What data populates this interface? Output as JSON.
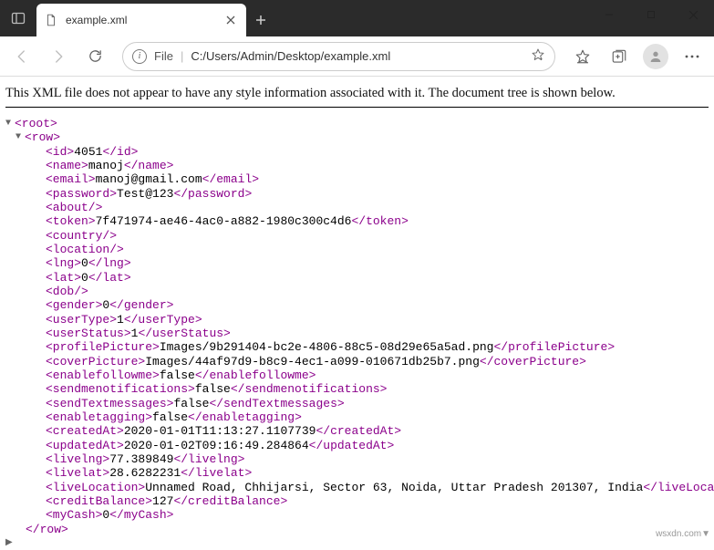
{
  "window": {
    "tab_label": "example.xml",
    "url_proto": "File",
    "url_path": "C:/Users/Admin/Desktop/example.xml"
  },
  "notice": "This XML file does not appear to have any style information associated with it. The document tree is shown below.",
  "xml": {
    "root_name": "root",
    "row_name": "row",
    "row_close": "</row>",
    "fields": [
      {
        "tag": "id",
        "value": "4051"
      },
      {
        "tag": "name",
        "value": "manoj"
      },
      {
        "tag": "email",
        "value": "manoj@gmail.com"
      },
      {
        "tag": "password",
        "value": "Test@123"
      },
      {
        "tag": "about",
        "empty": true
      },
      {
        "tag": "token",
        "value": "7f471974-ae46-4ac0-a882-1980c300c4d6"
      },
      {
        "tag": "country",
        "empty": true
      },
      {
        "tag": "location",
        "empty": true
      },
      {
        "tag": "lng",
        "value": "0"
      },
      {
        "tag": "lat",
        "value": "0"
      },
      {
        "tag": "dob",
        "empty": true
      },
      {
        "tag": "gender",
        "value": "0"
      },
      {
        "tag": "userType",
        "value": "1"
      },
      {
        "tag": "userStatus",
        "value": "1"
      },
      {
        "tag": "profilePicture",
        "value": "Images/9b291404-bc2e-4806-88c5-08d29e65a5ad.png"
      },
      {
        "tag": "coverPicture",
        "value": "Images/44af97d9-b8c9-4ec1-a099-010671db25b7.png"
      },
      {
        "tag": "enablefollowme",
        "value": "false"
      },
      {
        "tag": "sendmenotifications",
        "value": "false"
      },
      {
        "tag": "sendTextmessages",
        "value": "false"
      },
      {
        "tag": "enabletagging",
        "value": "false"
      },
      {
        "tag": "createdAt",
        "value": "2020-01-01T11:13:27.1107739"
      },
      {
        "tag": "updatedAt",
        "value": "2020-01-02T09:16:49.284864"
      },
      {
        "tag": "livelng",
        "value": "77.389849"
      },
      {
        "tag": "livelat",
        "value": "28.6282231"
      },
      {
        "tag": "liveLocation",
        "value": "Unnamed Road, Chhijarsi, Sector 63, Noida, Uttar Pradesh 201307, India"
      },
      {
        "tag": "creditBalance",
        "value": "127"
      },
      {
        "tag": "myCash",
        "value": "0"
      }
    ]
  },
  "watermark": "wsxdn.com▼"
}
